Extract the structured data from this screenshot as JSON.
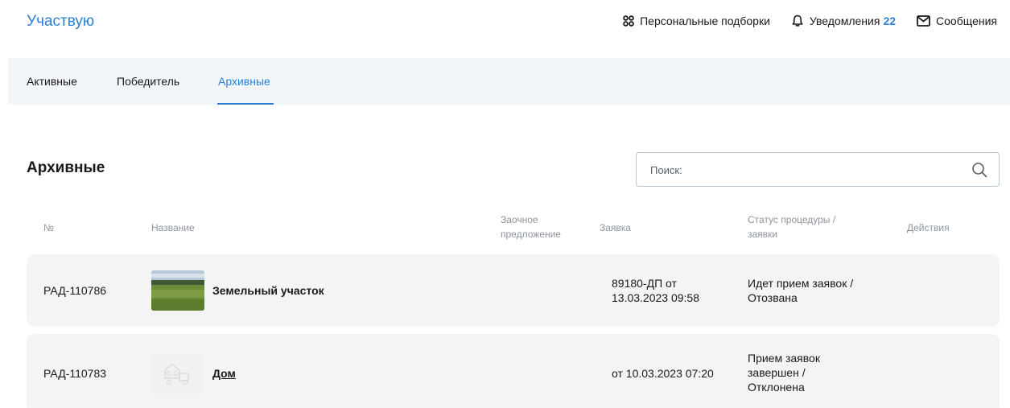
{
  "header": {
    "brand": "Участвую",
    "personal": "Персональные подборки",
    "notifications": "Уведомления",
    "notifications_count": "22",
    "messages": "Сообщения"
  },
  "tabs": [
    {
      "label": "Активные"
    },
    {
      "label": "Победитель"
    },
    {
      "label": "Архивные",
      "active": true
    }
  ],
  "section": {
    "title": "Архивные",
    "search_placeholder": "Поиск:"
  },
  "table": {
    "headers": {
      "number": "№",
      "name": "Название",
      "offer_line1": "Заочное",
      "offer_line2": "предложение",
      "application": "Заявка",
      "status_line1": "Статус процедуры /",
      "status_line2": "заявки",
      "actions": "Действия"
    },
    "rows": [
      {
        "number": "РАД-110786",
        "name": "Земельный участок",
        "image": "field-photo",
        "app_line1": "89180-ДП от",
        "app_line2": "13.03.2023 09:58",
        "status_line1": "Идет прием заявок /",
        "status_line2": "Отозвана"
      },
      {
        "number": "РАД-110783",
        "name": "Дом",
        "image": "house-placeholder",
        "app_line1": "от 10.03.2023 07:20",
        "status_line1": "Прием заявок",
        "status_line2": "завершен /",
        "status_line3": "Отклонена"
      }
    ]
  },
  "colors": {
    "accent": "#2a7fd4",
    "tabs_bg": "#f2f6fb",
    "row_bg": "#f4f4f4"
  }
}
